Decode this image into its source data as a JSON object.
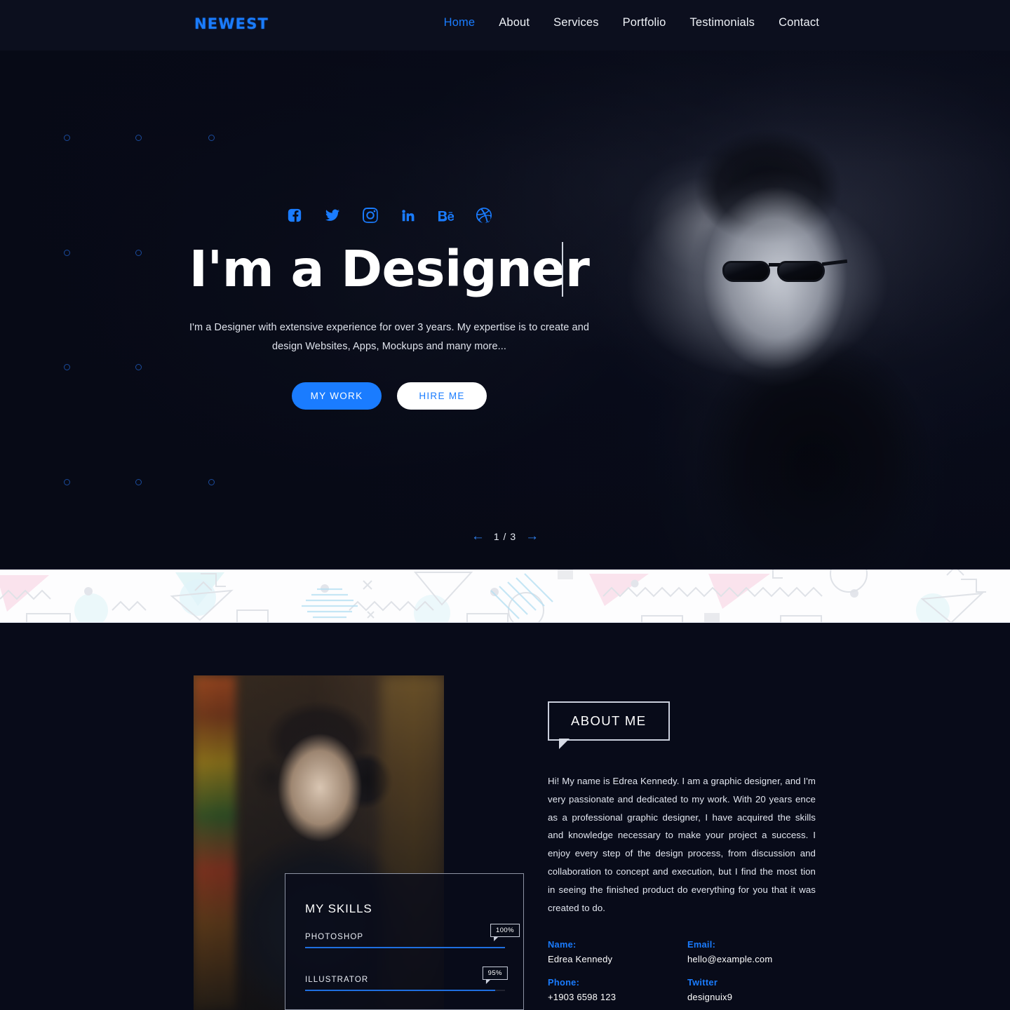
{
  "header": {
    "logo": "NEWEST",
    "nav": [
      {
        "label": "Home",
        "active": true
      },
      {
        "label": "About",
        "active": false
      },
      {
        "label": "Services",
        "active": false
      },
      {
        "label": "Portfolio",
        "active": false
      },
      {
        "label": "Testimonials",
        "active": false
      },
      {
        "label": "Contact",
        "active": false
      }
    ]
  },
  "hero": {
    "social": [
      {
        "name": "facebook-icon"
      },
      {
        "name": "twitter-icon"
      },
      {
        "name": "instagram-icon"
      },
      {
        "name": "linkedin-icon"
      },
      {
        "name": "behance-icon"
      },
      {
        "name": "dribbble-icon"
      }
    ],
    "title": "I'm a Designer",
    "description": "I'm a Designer with extensive experience for over 3 years. My expertise is to create and design Websites, Apps, Mockups and many more...",
    "primary_button": "MY WORK",
    "secondary_button": "HIRE ME",
    "slider": {
      "prev": "←",
      "next": "→",
      "counter": "1 / 3"
    }
  },
  "skills": {
    "title": "MY SKILLS",
    "items": [
      {
        "label": "PHOTOSHOP",
        "value": "100%",
        "percent": 100
      },
      {
        "label": "ILLUSTRATOR",
        "value": "95%",
        "percent": 95
      }
    ]
  },
  "about": {
    "badge": "ABOUT ME",
    "text": "Hi! My name is Edrea Kennedy. I am a graphic designer, and I'm very passionate and dedicated to my work. With 20 years ence as a professional graphic designer, I have acquired the skills and knowledge necessary to make your project a success. I enjoy every step of the design process, from discussion and collaboration to concept and execution, but I find the most tion in seeing the finished product do everything for you that it was created to do.",
    "info": [
      {
        "key": "Name:",
        "value": "Edrea Kennedy"
      },
      {
        "key": "Email:",
        "value": "hello@example.com"
      },
      {
        "key": "Phone:",
        "value": "+1903 6598 123"
      },
      {
        "key": "Twitter",
        "value": "designuix9"
      }
    ]
  },
  "colors": {
    "accent": "#1a7cff",
    "header_bg": "#0c0f1e",
    "page_bg": "#080b19",
    "text": "#ffffff",
    "divider_bg": "#fdfdfe"
  }
}
